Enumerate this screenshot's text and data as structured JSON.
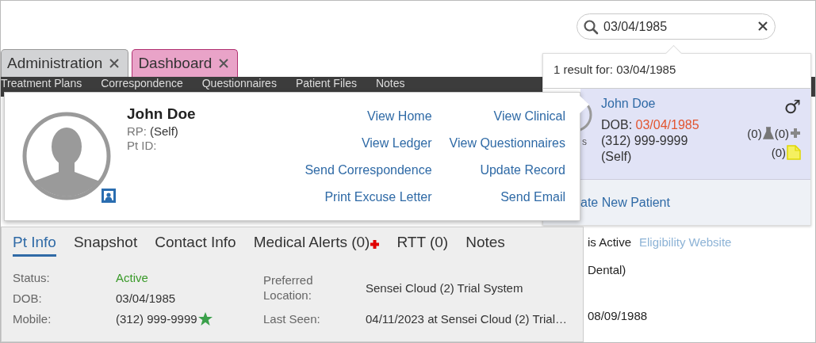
{
  "search": {
    "value": "03/04/1985"
  },
  "tabs": [
    {
      "label": "Administration",
      "selected": false
    },
    {
      "label": "Dashboard",
      "selected": true
    }
  ],
  "nav": [
    "Treatment Plans",
    "Correspondence",
    "Questionnaires",
    "Patient Files",
    "Notes"
  ],
  "background": {
    "rows": [
      [
        {
          "kind": "text",
          "text": "is Active"
        },
        {
          "kind": "link",
          "text": "Eligibility Website"
        }
      ],
      [
        {
          "kind": "text",
          "text": "Dental)"
        }
      ],
      [
        {
          "kind": "text",
          "text": "08/09/1988"
        }
      ]
    ]
  },
  "search_results": {
    "summary": "1 result for: 03/04/1985",
    "results": [
      {
        "name": "John Doe",
        "gender_symbol": "♂",
        "label_fragment": "s",
        "dob_label": "DOB:",
        "dob": "03/04/1985",
        "dob_match": true,
        "phone": "(312) 999-9999",
        "rp": "(Self)",
        "counts": [
          {
            "kind": "lab",
            "text": "(0)"
          },
          {
            "kind": "medical",
            "text": "(0)"
          },
          {
            "kind": "note",
            "text": "(0)"
          }
        ]
      }
    ],
    "footer": "ate New Patient"
  },
  "patient_card": {
    "name": "John Doe",
    "rp_label": "RP:",
    "rp_value": "(Self)",
    "pt_id_label": "Pt ID:",
    "actions": [
      "View Home",
      "View Clinical",
      "View Ledger",
      "View Questionnaires",
      "Send Correspondence",
      "Update Record",
      "Print Excuse Letter",
      "Send Email"
    ]
  },
  "patient_panel": {
    "tabs": [
      {
        "label": "Pt Info",
        "selected": true,
        "alert": false
      },
      {
        "label": "Snapshot",
        "selected": false,
        "alert": false
      },
      {
        "label": "Contact Info",
        "selected": false,
        "alert": false
      },
      {
        "label": "Medical Alerts (0)",
        "selected": false,
        "alert": true
      },
      {
        "label": "RTT (0)",
        "selected": false,
        "alert": false
      },
      {
        "label": "Notes",
        "selected": false,
        "alert": false
      }
    ],
    "left_fields": [
      {
        "label": "Status:",
        "value": "Active",
        "kind": "status"
      },
      {
        "label": "DOB:",
        "value": "03/04/1985",
        "kind": "text"
      },
      {
        "label": "Mobile:",
        "value": "(312) 999-9999",
        "kind": "preferred"
      }
    ],
    "right_fields": [
      {
        "label": "Preferred Location:",
        "value": "Sensei Cloud (2) Trial System",
        "kind": "text"
      },
      {
        "label": "Last Seen:",
        "value": "04/11/2023 at Sensei Cloud (2) Trial…",
        "kind": "text"
      }
    ]
  }
}
